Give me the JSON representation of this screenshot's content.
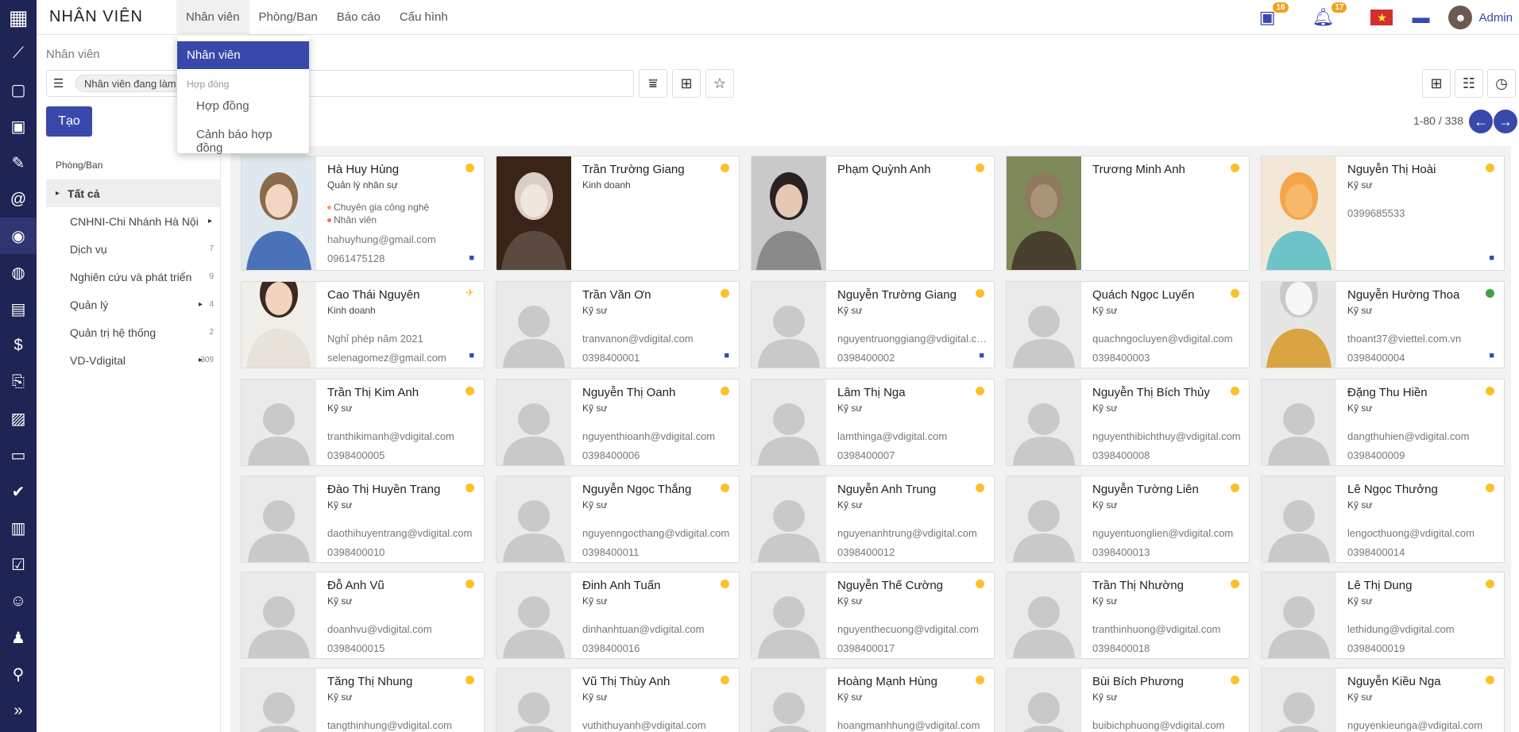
{
  "app": {
    "title": "NHÂN VIÊN",
    "user": "Admin"
  },
  "topmenu": [
    "Nhân viên",
    "Phòng/Ban",
    "Báo cáo",
    "Cấu hình"
  ],
  "dropdown": {
    "active": "Nhân viên",
    "header": "Hợp đồng",
    "items": [
      "Hợp đồng",
      "Cảnh báo hợp đồng"
    ]
  },
  "notifications": {
    "calendar": "16",
    "bell": "17"
  },
  "colors": {
    "accent": "#3949ab",
    "sidebar": "#1e2453",
    "status_yellow": "#fbc02d",
    "status_green": "#43a047"
  },
  "breadcrumb": "Nhân viên",
  "search": {
    "facet": "Nhân viên đang làm"
  },
  "create_label": "Tạo",
  "pager": "1-80 / 338",
  "panel": {
    "title": "Phòng/Ban",
    "items": [
      {
        "label": "Tất cả",
        "count": "",
        "arrow": false
      },
      {
        "label": "CNHNI-Chi Nhánh Hà Nội",
        "count": "",
        "arrow": true
      },
      {
        "label": "Dịch vụ",
        "count": "7",
        "arrow": false
      },
      {
        "label": "Nghiên cứu và phát triển",
        "count": "9",
        "arrow": false
      },
      {
        "label": "Quản lý",
        "count": "4",
        "arrow": true
      },
      {
        "label": "Quản trị hệ thống",
        "count": "2",
        "arrow": false
      },
      {
        "label": "VD-Vdigital",
        "count": "309",
        "arrow": true
      }
    ]
  },
  "employees": [
    {
      "name": "Hà Huy Hùng",
      "job": "Quản lý nhân sự",
      "tags": [
        "Chuyên gia công nghệ",
        "Nhân viên"
      ],
      "email": "hahuyhung@gmail.com",
      "phone": "0961475128",
      "status": "yellow",
      "photo": "girl-ball",
      "chat": true
    },
    {
      "name": "Trần Trường Giang",
      "job": "Kinh doanh",
      "tags": [],
      "email": "",
      "phone": "",
      "status": "yellow",
      "photo": "kitten",
      "chat": false
    },
    {
      "name": "Phạm Quỳnh Anh",
      "job": "",
      "tags": [],
      "email": "",
      "phone": "",
      "status": "yellow",
      "photo": "woman-cat",
      "chat": false
    },
    {
      "name": "Trương Minh Anh",
      "job": "",
      "tags": [],
      "email": "",
      "phone": "",
      "status": "yellow",
      "photo": "tabby",
      "chat": false
    },
    {
      "name": "Nguyễn Thị Hoài",
      "job": "Kỹ sư",
      "tags": [],
      "email": "0399685533",
      "phone": "",
      "status": "yellow",
      "photo": "cartoon",
      "chat": true
    },
    {
      "name": "Cao Thái Nguyên",
      "job": "Kinh doanh",
      "tags": [],
      "email": "Nghỉ phép năm 2021",
      "phone": "selenagomez@gmail.com",
      "status": "plane",
      "photo": "girl",
      "chat": true
    },
    {
      "name": "Trần Văn Ơn",
      "job": "Kỹ sư",
      "tags": [],
      "email": "tranvanon@vdigital.com",
      "phone": "0398400001",
      "status": "yellow",
      "photo": "",
      "chat": true
    },
    {
      "name": "Nguyễn Trường Giang",
      "job": "Kỹ sư",
      "tags": [],
      "email": "nguyentruonggiang@vdigital.com",
      "phone": "0398400002",
      "status": "yellow",
      "photo": "",
      "chat": true
    },
    {
      "name": "Quách Ngọc Luyến",
      "job": "Kỹ sư",
      "tags": [],
      "email": "quachngocluyen@vdigital.com",
      "phone": "0398400003",
      "status": "yellow",
      "photo": "",
      "chat": false
    },
    {
      "name": "Nguyễn Hường Thoa",
      "job": "Kỹ sư",
      "tags": [],
      "email": "thoant37@viettel.com.vn",
      "phone": "0398400004",
      "status": "green",
      "photo": "drawing",
      "chat": true
    },
    {
      "name": "Trần Thị Kim Anh",
      "job": "Kỹ sư",
      "tags": [],
      "email": "tranthikimanh@vdigital.com",
      "phone": "0398400005",
      "status": "yellow",
      "photo": "",
      "chat": false
    },
    {
      "name": "Nguyễn Thị Oanh",
      "job": "Kỹ sư",
      "tags": [],
      "email": "nguyenthioanh@vdigital.com",
      "phone": "0398400006",
      "status": "yellow",
      "photo": "",
      "chat": false
    },
    {
      "name": "Lâm Thị Nga",
      "job": "Kỹ sư",
      "tags": [],
      "email": "lamthinga@vdigital.com",
      "phone": "0398400007",
      "status": "yellow",
      "photo": "",
      "chat": false
    },
    {
      "name": "Nguyễn Thị Bích Thủy",
      "job": "Kỹ sư",
      "tags": [],
      "email": "nguyenthibichthuy@vdigital.com",
      "phone": "0398400008",
      "status": "yellow",
      "photo": "",
      "chat": false
    },
    {
      "name": "Đặng Thu Hiền",
      "job": "Kỹ sư",
      "tags": [],
      "email": "dangthuhien@vdigital.com",
      "phone": "0398400009",
      "status": "yellow",
      "photo": "",
      "chat": false
    },
    {
      "name": "Đào Thị Huyền Trang",
      "job": "Kỹ sư",
      "tags": [],
      "email": "daothihuyentrang@vdigital.com",
      "phone": "0398400010",
      "status": "yellow",
      "photo": "",
      "chat": false
    },
    {
      "name": "Nguyễn Ngọc Thắng",
      "job": "Kỹ sư",
      "tags": [],
      "email": "nguyenngocthang@vdigital.com",
      "phone": "0398400011",
      "status": "yellow",
      "photo": "",
      "chat": false
    },
    {
      "name": "Nguyễn Anh Trung",
      "job": "Kỹ sư",
      "tags": [],
      "email": "nguyenanhtrung@vdigital.com",
      "phone": "0398400012",
      "status": "yellow",
      "photo": "",
      "chat": false
    },
    {
      "name": "Nguyễn Tường Liên",
      "job": "Kỹ sư",
      "tags": [],
      "email": "nguyentuonglien@vdigital.com",
      "phone": "0398400013",
      "status": "yellow",
      "photo": "",
      "chat": false
    },
    {
      "name": "Lê Ngọc Thưởng",
      "job": "Kỹ sư",
      "tags": [],
      "email": "lengocthuong@vdigital.com",
      "phone": "0398400014",
      "status": "yellow",
      "photo": "",
      "chat": false
    },
    {
      "name": "Đỗ Anh Vũ",
      "job": "Kỹ sư",
      "tags": [],
      "email": "doanhvu@vdigital.com",
      "phone": "0398400015",
      "status": "yellow",
      "photo": "",
      "chat": false
    },
    {
      "name": "Đinh Anh Tuấn",
      "job": "Kỹ sư",
      "tags": [],
      "email": "dinhanhtuan@vdigital.com",
      "phone": "0398400016",
      "status": "yellow",
      "photo": "",
      "chat": false
    },
    {
      "name": "Nguyễn Thế Cường",
      "job": "Kỹ sư",
      "tags": [],
      "email": "nguyenthecuong@vdigital.com",
      "phone": "0398400017",
      "status": "yellow",
      "photo": "",
      "chat": false
    },
    {
      "name": "Trần Thị Nhường",
      "job": "Kỹ sư",
      "tags": [],
      "email": "tranthinhuong@vdigital.com",
      "phone": "0398400018",
      "status": "yellow",
      "photo": "",
      "chat": false
    },
    {
      "name": "Lê Thị Dung",
      "job": "Kỹ sư",
      "tags": [],
      "email": "lethidung@vdigital.com",
      "phone": "0398400019",
      "status": "yellow",
      "photo": "",
      "chat": false
    },
    {
      "name": "Tăng Thị Nhung",
      "job": "Kỹ sư",
      "tags": [],
      "email": "tangthinhung@vdigital.com",
      "phone": "",
      "status": "yellow",
      "photo": "",
      "chat": false
    },
    {
      "name": "Vũ Thị Thùy Anh",
      "job": "Kỹ sư",
      "tags": [],
      "email": "vuthithuyanh@vdigital.com",
      "phone": "",
      "status": "yellow",
      "photo": "",
      "chat": false
    },
    {
      "name": "Hoàng Mạnh Hùng",
      "job": "Kỹ sư",
      "tags": [],
      "email": "hoangmanhhung@vdigital.com",
      "phone": "",
      "status": "yellow",
      "photo": "",
      "chat": false
    },
    {
      "name": "Bùi Bích Phương",
      "job": "Kỹ sư",
      "tags": [],
      "email": "buibichphuong@vdigital.com",
      "phone": "",
      "status": "yellow",
      "photo": "",
      "chat": false
    },
    {
      "name": "Nguyễn Kiều Nga",
      "job": "Kỹ sư",
      "tags": [],
      "email": "nguyenkieunga@vdigital.com",
      "phone": "",
      "status": "yellow",
      "photo": "",
      "chat": false
    }
  ]
}
